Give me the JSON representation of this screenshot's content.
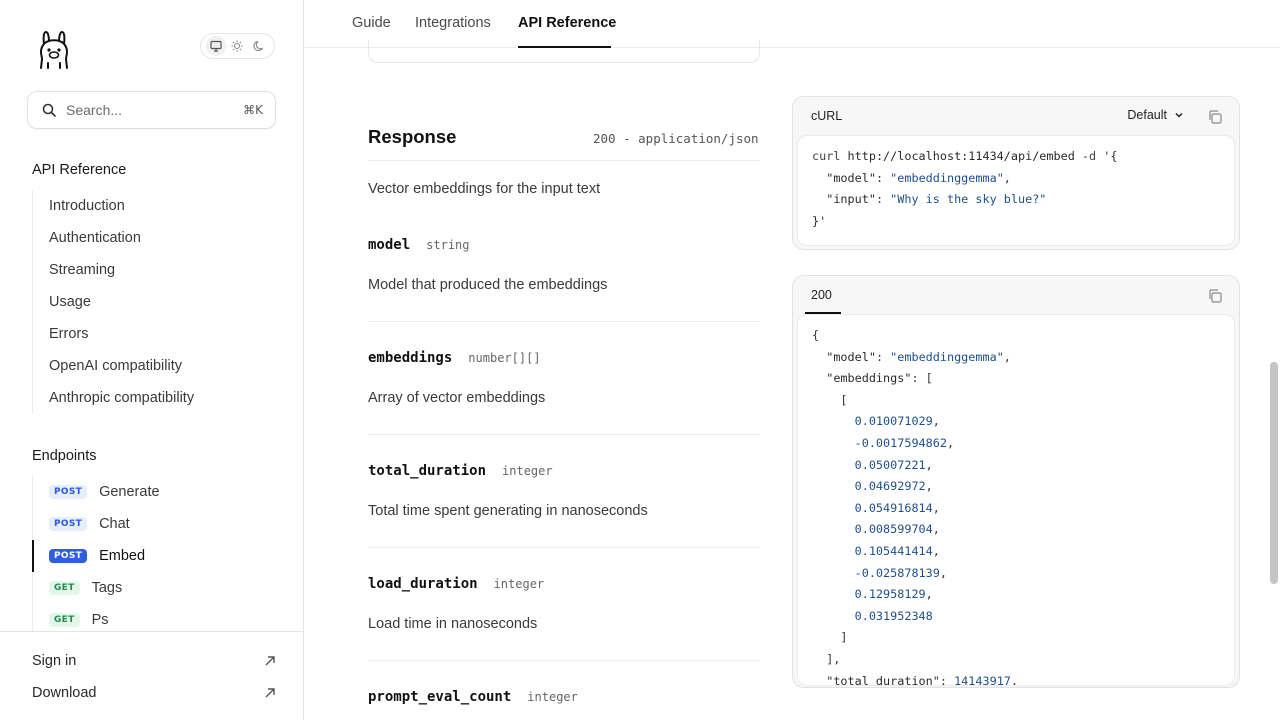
{
  "sidebar": {
    "search": {
      "placeholder": "Search...",
      "shortcut": "⌘K"
    },
    "sections": [
      {
        "title": "API Reference",
        "items": [
          {
            "label": "Introduction"
          },
          {
            "label": "Authentication"
          },
          {
            "label": "Streaming"
          },
          {
            "label": "Usage"
          },
          {
            "label": "Errors"
          },
          {
            "label": "OpenAI compatibility"
          },
          {
            "label": "Anthropic compatibility"
          }
        ]
      },
      {
        "title": "Endpoints",
        "items": [
          {
            "method": "POST",
            "label": "Generate"
          },
          {
            "method": "POST",
            "label": "Chat"
          },
          {
            "method": "POST",
            "label": "Embed",
            "active": true
          },
          {
            "method": "GET",
            "label": "Tags"
          },
          {
            "method": "GET",
            "label": "Ps"
          }
        ]
      }
    ],
    "footer": [
      {
        "label": "Sign in"
      },
      {
        "label": "Download"
      }
    ]
  },
  "topnav": {
    "tabs": [
      {
        "label": "Guide"
      },
      {
        "label": "Integrations"
      },
      {
        "label": "API Reference",
        "active": true
      }
    ]
  },
  "response": {
    "title": "Response",
    "meta": "200 - application/json",
    "description": "Vector embeddings for the input text",
    "fields": [
      {
        "name": "model",
        "type": "string",
        "description": "Model that produced the embeddings"
      },
      {
        "name": "embeddings",
        "type": "number[][]",
        "description": "Array of vector embeddings"
      },
      {
        "name": "total_duration",
        "type": "integer",
        "description": "Total time spent generating in nanoseconds"
      },
      {
        "name": "load_duration",
        "type": "integer",
        "description": "Load time in nanoseconds"
      },
      {
        "name": "prompt_eval_count",
        "type": "integer",
        "description": ""
      }
    ]
  },
  "request_panel": {
    "title": "cURL",
    "dropdown": "Default",
    "code": {
      "cmd": "curl",
      "url": "http://localhost:11434/api/embed",
      "flag": "-d",
      "open": "'{",
      "model_key": "\"model\"",
      "model_val": "\"embeddinggemma\"",
      "input_key": "\"input\"",
      "input_val": "\"Why is the sky blue?\"",
      "close": "}'"
    }
  },
  "response_panel": {
    "tab": "200",
    "model_key": "\"model\"",
    "model_val": "\"embeddinggemma\"",
    "embeddings_key": "\"embeddings\"",
    "values": [
      "0.010071029",
      "-0.0017594862",
      "0.05007221",
      "0.04692972",
      "0.054916814",
      "0.008599704",
      "0.105441414",
      "-0.025878139",
      "0.12958129",
      "0.031952348"
    ],
    "total_duration_key": "\"total_duration\"",
    "total_duration_val": "14143917"
  }
}
